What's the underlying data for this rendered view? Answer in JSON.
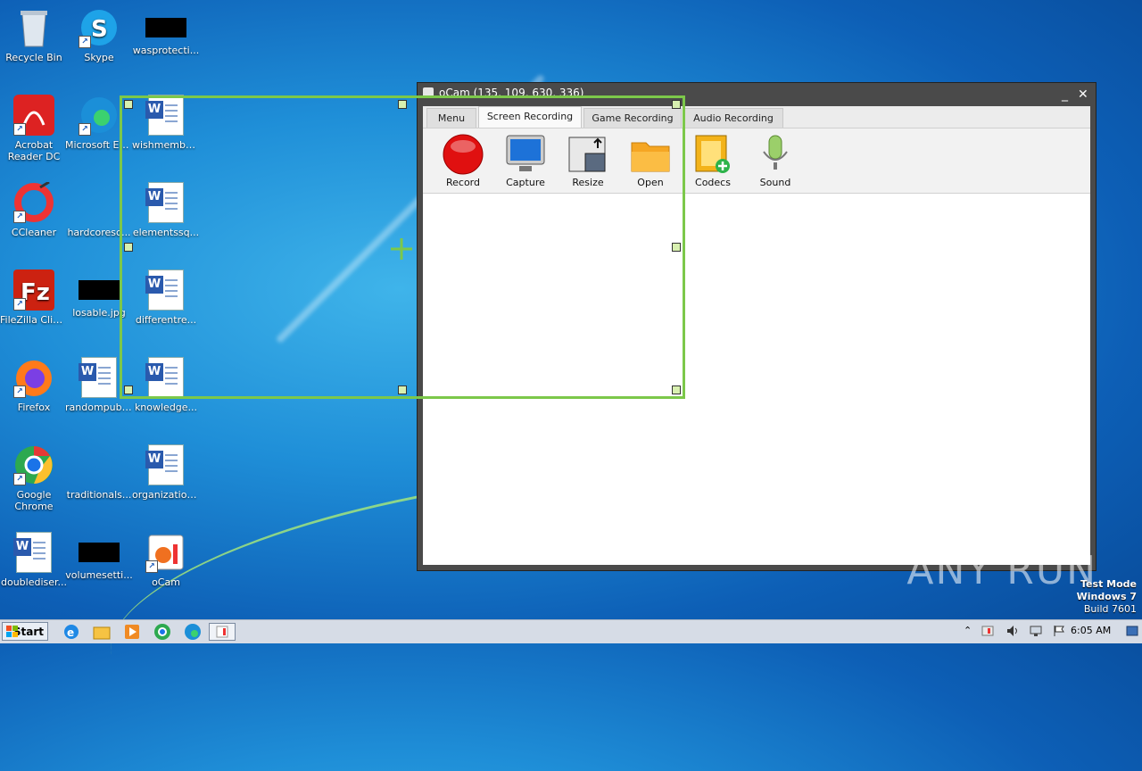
{
  "desktop": {
    "icons": [
      {
        "label": "Recycle Bin"
      },
      {
        "label": "Skype"
      },
      {
        "label": "wasprotecti..."
      },
      {
        "label": "Acrobat Reader DC"
      },
      {
        "label": "Microsoft Edge"
      },
      {
        "label": "wishmember..."
      },
      {
        "label": "CCleaner"
      },
      {
        "label": "hardcoresc..."
      },
      {
        "label": "elementssq..."
      },
      {
        "label": "FileZilla Client"
      },
      {
        "label": "losable.jpg"
      },
      {
        "label": "differentre..."
      },
      {
        "label": "Firefox"
      },
      {
        "label": "randompubl..."
      },
      {
        "label": "knowledge..."
      },
      {
        "label": "Google Chrome"
      },
      {
        "label": "traditionals..."
      },
      {
        "label": "organization..."
      },
      {
        "label": "doublediser..."
      },
      {
        "label": "volumesetti..."
      },
      {
        "label": "oCam"
      }
    ]
  },
  "ocam": {
    "title": "oCam (135, 109, 630, 336)",
    "tabs": [
      "Menu",
      "Screen Recording",
      "Game Recording",
      "Audio Recording"
    ],
    "active_tab": "Screen Recording",
    "toolbar": [
      "Record",
      "Capture",
      "Resize",
      "Open",
      "Codecs",
      "Sound"
    ]
  },
  "taskbar": {
    "start_label": "Start",
    "clock": "6:05 AM"
  },
  "watermark": "ANY RUN",
  "os_info": {
    "line1": "Test Mode",
    "line2": "Windows 7",
    "line3": "Build 7601"
  },
  "colors": {
    "selection": "#7cc84a",
    "desktop_bg": "#1f8fd8"
  }
}
